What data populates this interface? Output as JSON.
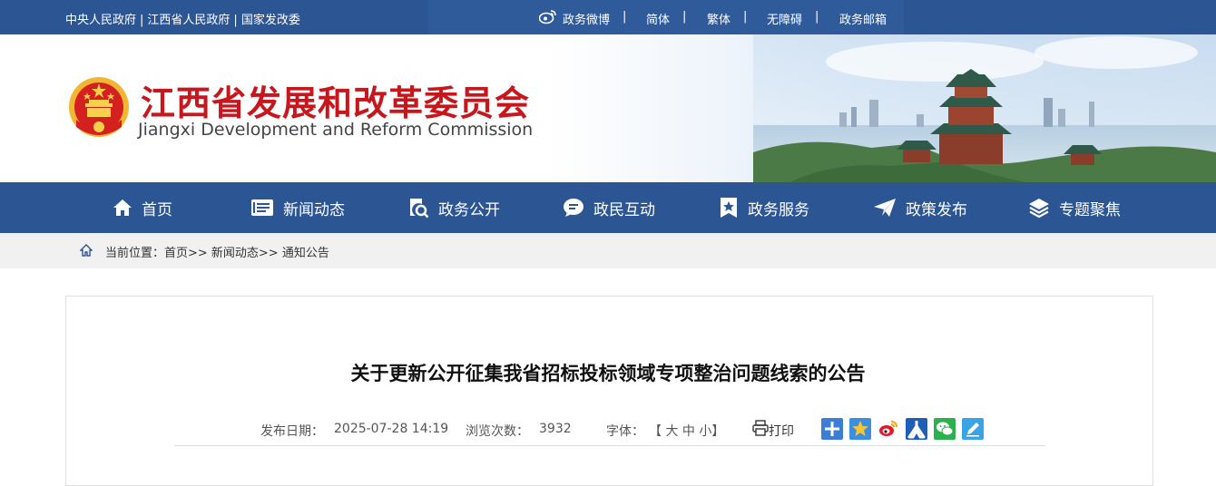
{
  "topbar": {
    "links": [
      "中央人民政府",
      "江西省人民政府",
      "国家发改委"
    ],
    "sep": "|",
    "weibo": "政务微博",
    "simplified": "简体",
    "traditional": "繁体",
    "accessibility": "无障碍",
    "mail": "政务邮箱",
    "bar": "|"
  },
  "banner": {
    "title_cn": "江西省发展和改革委员会",
    "title_en": "Jiangxi Development and Reform Commission"
  },
  "nav": {
    "items": [
      "首页",
      "新闻动态",
      "政务公开",
      "政民互动",
      "政务服务",
      "政策发布",
      "专题聚焦"
    ]
  },
  "breadcrumb": {
    "text": "当前位置：首页>> 新闻动态>> 通知公告"
  },
  "article": {
    "title": "关于更新公开征集我省招标投标领域专项整治问题线索的公告",
    "date_label": "发布日期：",
    "date_value": "2025-07-28 14:19",
    "views_label": "浏览次数：",
    "views_value": "3932",
    "font_label": "字体：",
    "font_sizes": "【 大 中 小】",
    "print_label": "打印"
  },
  "share": {
    "icons": [
      "plus-share-icon",
      "qzone-icon",
      "weibo-icon",
      "renmin-icon",
      "wechat-icon",
      "edit-icon"
    ]
  },
  "colors": {
    "primary": "#2c5593",
    "brand_red": "#c8161d"
  }
}
